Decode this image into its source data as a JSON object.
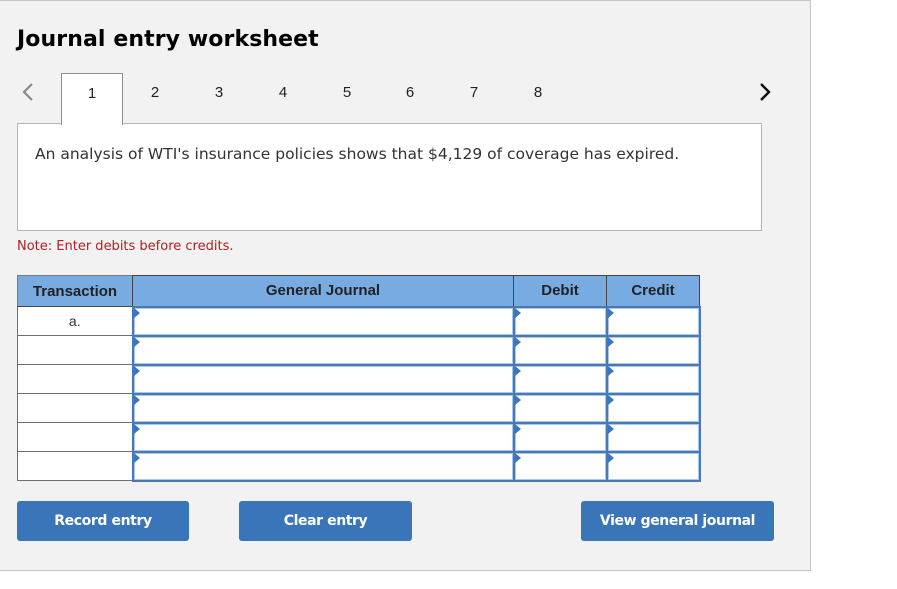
{
  "title": "Journal entry worksheet",
  "navigation": {
    "prev_icon": "chevron-left-icon",
    "next_icon": "chevron-right-icon",
    "active_tab": "1",
    "tabs": [
      "1",
      "2",
      "3",
      "4",
      "5",
      "6",
      "7",
      "8"
    ]
  },
  "question": {
    "text": "An analysis of WTI's insurance policies shows that $4,129 of coverage has expired."
  },
  "note": "Note: Enter debits before credits.",
  "table": {
    "headers": {
      "transaction": "Transaction",
      "general_journal": "General Journal",
      "debit": "Debit",
      "credit": "Credit"
    },
    "rows": [
      {
        "transaction": "a.",
        "account": "",
        "debit": "",
        "credit": ""
      },
      {
        "transaction": "",
        "account": "",
        "debit": "",
        "credit": ""
      },
      {
        "transaction": "",
        "account": "",
        "debit": "",
        "credit": ""
      },
      {
        "transaction": "",
        "account": "",
        "debit": "",
        "credit": ""
      },
      {
        "transaction": "",
        "account": "",
        "debit": "",
        "credit": ""
      },
      {
        "transaction": "",
        "account": "",
        "debit": "",
        "credit": ""
      }
    ]
  },
  "buttons": {
    "record": "Record entry",
    "clear": "Clear entry",
    "view": "View general journal"
  },
  "colors": {
    "header_bg": "#78abe2",
    "button_bg": "#3a74b9",
    "note_text": "#b02020",
    "input_border": "#4a79b2"
  }
}
